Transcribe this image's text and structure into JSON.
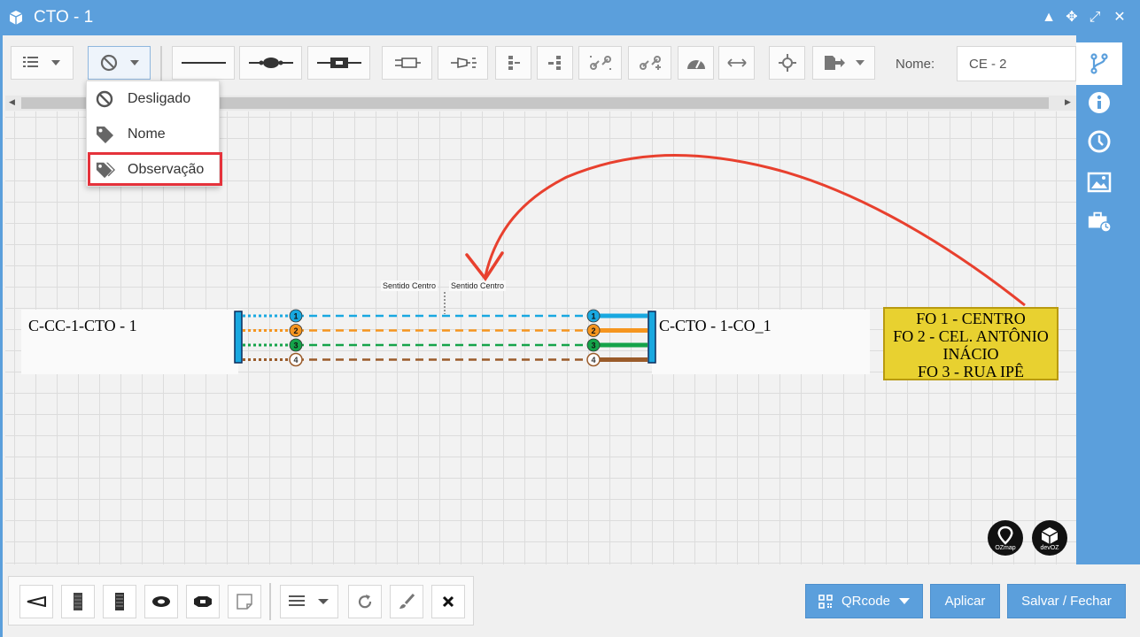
{
  "window": {
    "title": "CTO - 1"
  },
  "toolbar": {
    "nome_label": "Nome:",
    "nome_value": "CE - 2"
  },
  "label_menu": {
    "items": [
      {
        "label": "Desligado",
        "icon": "ban-icon"
      },
      {
        "label": "Nome",
        "icon": "tag-icon"
      },
      {
        "label": "Observação",
        "icon": "tags-icon",
        "highlighted": true
      }
    ]
  },
  "diagram": {
    "left_box": "C-CC-1-CTO - 1",
    "right_box": "C-CTO - 1-CO_1",
    "sentido_left": "Sentido Centro",
    "sentido_right": "Sentido Centro",
    "fibers": [
      {
        "num": "1",
        "color": "#19a8e0"
      },
      {
        "num": "2",
        "color": "#f5951f"
      },
      {
        "num": "3",
        "color": "#15a34a"
      },
      {
        "num": "4",
        "color": "#9a5b2a"
      }
    ],
    "note_lines": [
      "FO 1 - CENTRO",
      "FO 2 - CEL. ANTÔNIO",
      "INÁCIO",
      "FO 3 - RUA IPÊ"
    ],
    "logo_left": "OZmap",
    "logo_right": "devOZ"
  },
  "footer": {
    "qrcode_label": "QRcode",
    "apply_label": "Aplicar",
    "save_label": "Salvar / Fechar"
  },
  "colors": {
    "accent": "#5b9fdc",
    "highlight_box": "#e5323b",
    "annotation_arrow": "#e8402e",
    "note_bg": "#e8d130"
  }
}
